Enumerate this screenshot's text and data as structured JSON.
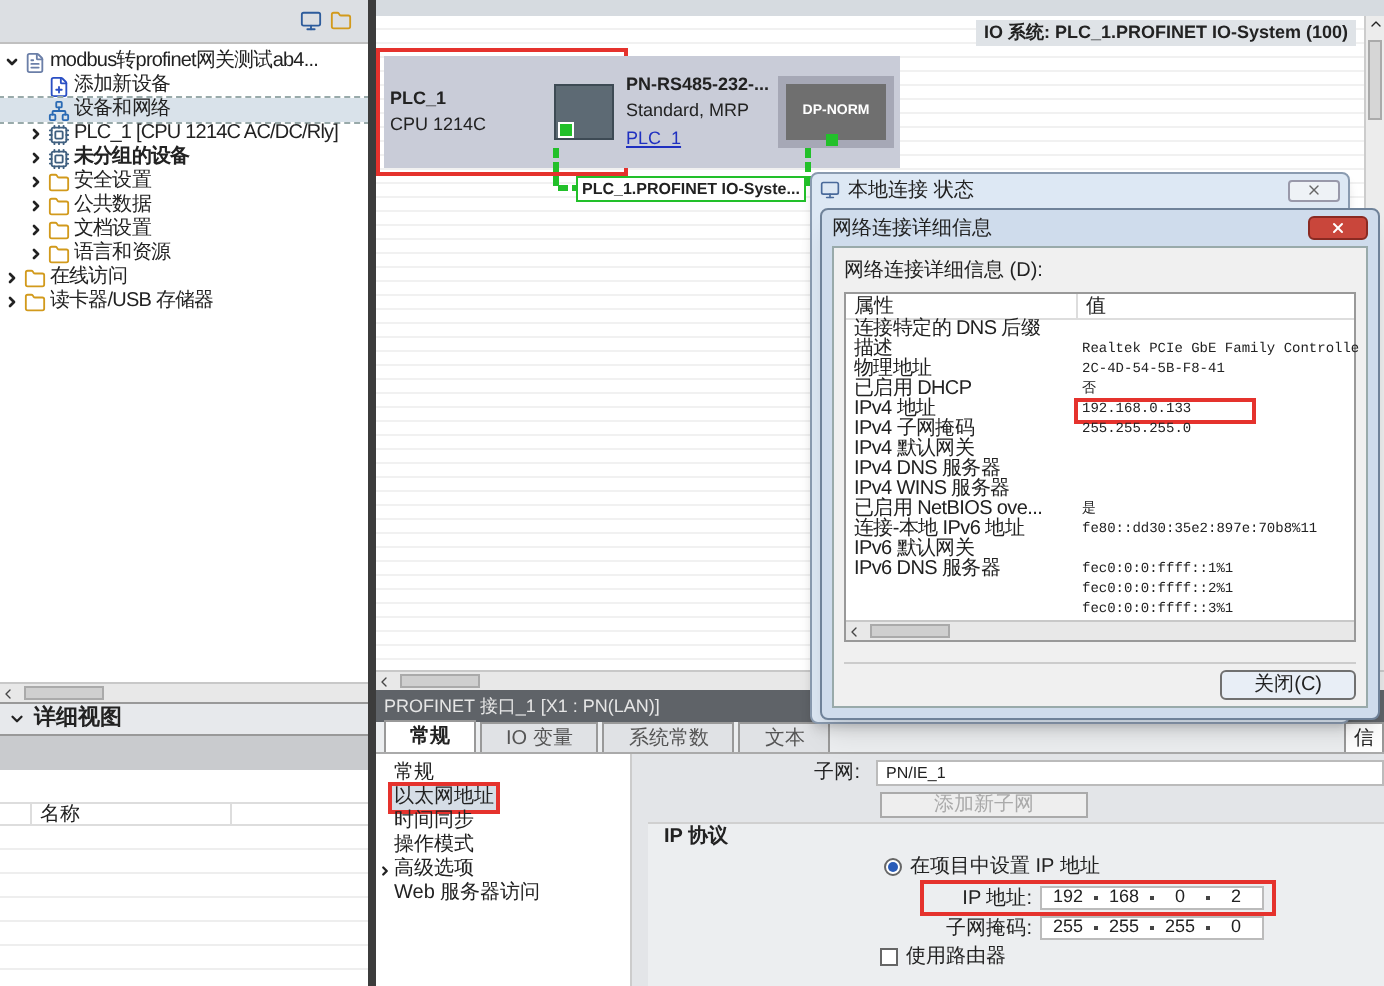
{
  "project_tree": {
    "items": [
      {
        "kind": "project",
        "label": "modbus转profinet网关测试ab4...",
        "expanded": true,
        "selected": false,
        "children": [
          {
            "kind": "command",
            "label": "添加新设备",
            "selected": false
          },
          {
            "kind": "network",
            "label": "设备和网络",
            "selected": true
          },
          {
            "kind": "device",
            "label": "PLC_1 [CPU 1214C AC/DC/Rly]",
            "expanded": false,
            "selected": false
          },
          {
            "kind": "device",
            "label": "未分组的设备",
            "expanded": false,
            "selected": false,
            "bold": true
          },
          {
            "kind": "folder",
            "label": "安全设置",
            "expanded": false,
            "selected": false
          },
          {
            "kind": "folder",
            "label": "公共数据",
            "expanded": false,
            "selected": false
          },
          {
            "kind": "folder",
            "label": "文档设置",
            "expanded": false,
            "selected": false
          },
          {
            "kind": "folder",
            "label": "语言和资源",
            "expanded": false,
            "selected": false
          }
        ]
      },
      {
        "kind": "folder",
        "label": "在线访问",
        "expanded": false,
        "selected": false
      },
      {
        "kind": "folder",
        "label": "读卡器/USB 存储器",
        "expanded": false,
        "selected": false
      }
    ]
  },
  "detail_view": {
    "title": "详细视图",
    "columns": [
      "名称"
    ]
  },
  "network_view": {
    "io_system_label": "IO 系统: PLC_1.PROFINET IO-System (100)",
    "devices": [
      {
        "name": "PLC_1",
        "type": "CPU 1214C",
        "highlighted": true
      },
      {
        "name": "PN-RS485-232-...",
        "type": "Standard, MRP",
        "link": "PLC_1",
        "module": "DP-NORM",
        "highlighted": false
      }
    ],
    "network_label": "PLC_1.PROFINET IO-Syste..."
  },
  "status_window": {
    "title": "本地连接 状态"
  },
  "details_dialog": {
    "title": "网络连接详细信息",
    "list_label": "网络连接详细信息 (D):",
    "columns": [
      "属性",
      "值"
    ],
    "rows": [
      {
        "property": "连接特定的 DNS 后缀"
      },
      {
        "property": "描述",
        "value": "Realtek PCIe GbE Family Controlle"
      },
      {
        "property": "物理地址",
        "value": "2C-4D-54-5B-F8-41"
      },
      {
        "property": "已启用 DHCP",
        "value": "否"
      },
      {
        "property": "IPv4 地址",
        "value": "192.168.0.133",
        "highlighted": true
      },
      {
        "property": "IPv4 子网掩码",
        "value": "255.255.255.0"
      },
      {
        "property": "IPv4 默认网关"
      },
      {
        "property": "IPv4 DNS 服务器"
      },
      {
        "property": "IPv4 WINS 服务器"
      },
      {
        "property": "已启用 NetBIOS ove...",
        "value": "是"
      },
      {
        "property": "连接-本地 IPv6 地址",
        "value": "fe80::dd30:35e2:897e:70b8%11"
      },
      {
        "property": "IPv6 默认网关"
      },
      {
        "property": "IPv6 DNS 服务器",
        "value": "fec0:0:0:ffff::1%1"
      },
      {
        "value": "fec0:0:0:ffff::2%1"
      },
      {
        "value": "fec0:0:0:ffff::3%1"
      }
    ],
    "button": "关闭(C)"
  },
  "inspector": {
    "title": "PROFINET 接口_1 [X1 : PN(LAN)]",
    "tabs": [
      {
        "label": "常规",
        "selected": true
      },
      {
        "label": "IO 变量",
        "selected": false
      },
      {
        "label": "系统常数",
        "selected": false
      },
      {
        "label": "文本",
        "selected": false
      }
    ],
    "side_tab": "信",
    "nav": [
      {
        "label": "常规",
        "selected": false
      },
      {
        "label": "以太网地址",
        "selected": true
      },
      {
        "label": "时间同步",
        "selected": false
      },
      {
        "label": "操作模式",
        "selected": false
      },
      {
        "label": "高级选项",
        "selected": false,
        "expanded": false
      },
      {
        "label": "Web 服务器访问",
        "selected": false
      }
    ],
    "subnet_label": "子网:",
    "subnet_value": "PN/IE_1",
    "add_subnet_button": {
      "label": "添加新子网",
      "disabled": true
    },
    "section_title": "IP 协议",
    "ip_option": {
      "label": "在项目中设置 IP 地址",
      "selected": true
    },
    "ip_address": {
      "label": "IP 地址:",
      "octets": [
        "192",
        "168",
        "0",
        "2"
      ],
      "highlighted": true
    },
    "subnet_mask": {
      "label": "子网掩码:",
      "octets": [
        "255",
        "255",
        "255",
        "0"
      ]
    },
    "router_option": {
      "label": "使用路由器",
      "checked": false
    }
  }
}
